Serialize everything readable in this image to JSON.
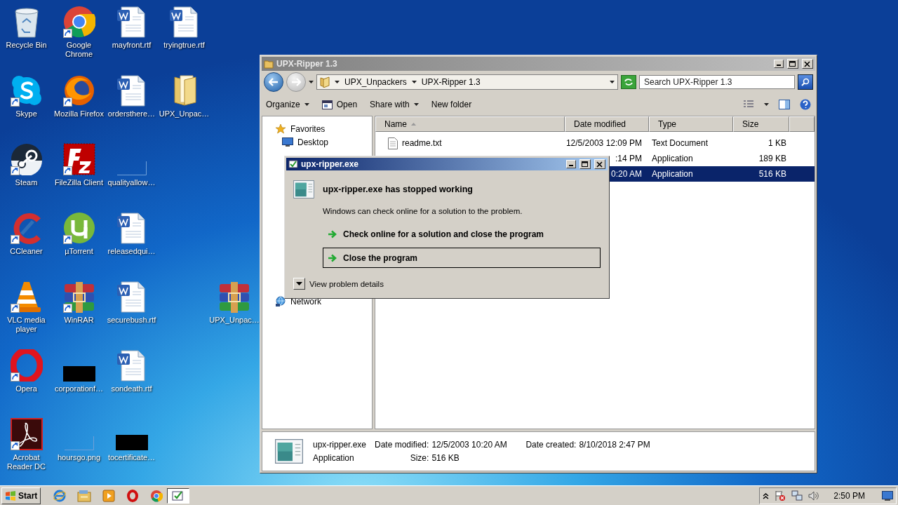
{
  "desktop": {
    "icons": [
      {
        "label": "Recycle Bin",
        "kind": "recycle",
        "shortcut": false
      },
      {
        "label": "Google Chrome",
        "kind": "chrome",
        "shortcut": true
      },
      {
        "label": "mayfront.rtf",
        "kind": "word",
        "shortcut": false
      },
      {
        "label": "tryingtrue.rtf",
        "kind": "word",
        "shortcut": false
      },
      {
        "label": "Skype",
        "kind": "skype",
        "shortcut": true
      },
      {
        "label": "Mozilla Firefox",
        "kind": "firefox",
        "shortcut": true
      },
      {
        "label": "ordersthere…",
        "kind": "word",
        "shortcut": false
      },
      {
        "label": "UPX_Unpac…",
        "kind": "folder",
        "shortcut": false
      },
      {
        "label": "Steam",
        "kind": "steam",
        "shortcut": true
      },
      {
        "label": "FileZilla Client",
        "kind": "filezilla",
        "shortcut": true
      },
      {
        "label": "qualityallow…",
        "kind": "blank",
        "shortcut": false
      },
      {
        "label": "CCleaner",
        "kind": "ccleaner",
        "shortcut": true
      },
      {
        "label": "µTorrent",
        "kind": "utorrent",
        "shortcut": true
      },
      {
        "label": "releasedqui…",
        "kind": "word",
        "shortcut": false
      },
      {
        "label": "VLC media player",
        "kind": "vlc",
        "shortcut": true
      },
      {
        "label": "WinRAR",
        "kind": "winrar",
        "shortcut": true
      },
      {
        "label": "securebush.rtf",
        "kind": "word",
        "shortcut": false
      },
      {
        "label": "UPX_Unpac…",
        "kind": "winrar",
        "shortcut": false
      },
      {
        "label": "Opera",
        "kind": "opera",
        "shortcut": true
      },
      {
        "label": "corporationf…",
        "kind": "black",
        "shortcut": false
      },
      {
        "label": "sondeath.rtf",
        "kind": "word",
        "shortcut": false
      },
      {
        "label": "Acrobat Reader DC",
        "kind": "acrobat",
        "shortcut": true
      },
      {
        "label": "hoursgo.png",
        "kind": "blank",
        "shortcut": false
      },
      {
        "label": "tocertificate…",
        "kind": "black",
        "shortcut": false
      }
    ]
  },
  "explorer": {
    "title": "UPX-Ripper 1.3",
    "breadcrumb": [
      "UPX_Unpackers",
      "UPX-Ripper 1.3"
    ],
    "search": {
      "placeholder": "Search UPX-Ripper 1.3"
    },
    "toolbar": [
      {
        "label": "Organize",
        "kind": "menu"
      },
      {
        "label": "Open",
        "kind": "open"
      },
      {
        "label": "Share with",
        "kind": "menu"
      },
      {
        "label": "New folder",
        "kind": "plain"
      }
    ],
    "nav": {
      "favorites": "Favorites",
      "items": [
        "Desktop"
      ],
      "network": "Network"
    },
    "columns": [
      {
        "label": "Name",
        "sorted": true
      },
      {
        "label": "Date modified",
        "sorted": false
      },
      {
        "label": "Type",
        "sorted": false
      },
      {
        "label": "Size",
        "sorted": false
      }
    ],
    "rows": [
      {
        "name": "readme.txt",
        "date": "12/5/2003 12:09 PM",
        "type": "Text Document",
        "size": "1 KB",
        "selected": false
      },
      {
        "date": ":14 PM",
        "type": "Application",
        "size": "189 KB",
        "selected": false
      },
      {
        "date": "0:20 AM",
        "type": "Application",
        "size": "516 KB",
        "selected": true
      }
    ],
    "details": {
      "name": "upx-ripper.exe",
      "type": "Application",
      "fields": [
        {
          "label": "Date modified:",
          "value": "12/5/2003 10:20 AM"
        },
        {
          "label": "Date created:",
          "value": "8/10/2018 2:47 PM"
        },
        {
          "label": "Size:",
          "value": "516 KB"
        }
      ]
    }
  },
  "dialog": {
    "title": "upx-ripper.exe",
    "heading": "upx-ripper.exe has stopped working",
    "message": "Windows can check online for a solution to the problem.",
    "options": [
      {
        "label": "Check online for a solution and close the program",
        "selected": false
      },
      {
        "label": "Close the program",
        "selected": true
      }
    ],
    "details_toggle": "View problem details"
  },
  "taskbar": {
    "start": "Start",
    "quick_launch": [
      {
        "kind": "ie"
      },
      {
        "kind": "explorer"
      },
      {
        "kind": "media"
      },
      {
        "kind": "opera"
      },
      {
        "kind": "chrome"
      }
    ],
    "tasks": [
      {
        "kind": "app",
        "selected": true
      }
    ],
    "clock": "2:50 PM"
  }
}
